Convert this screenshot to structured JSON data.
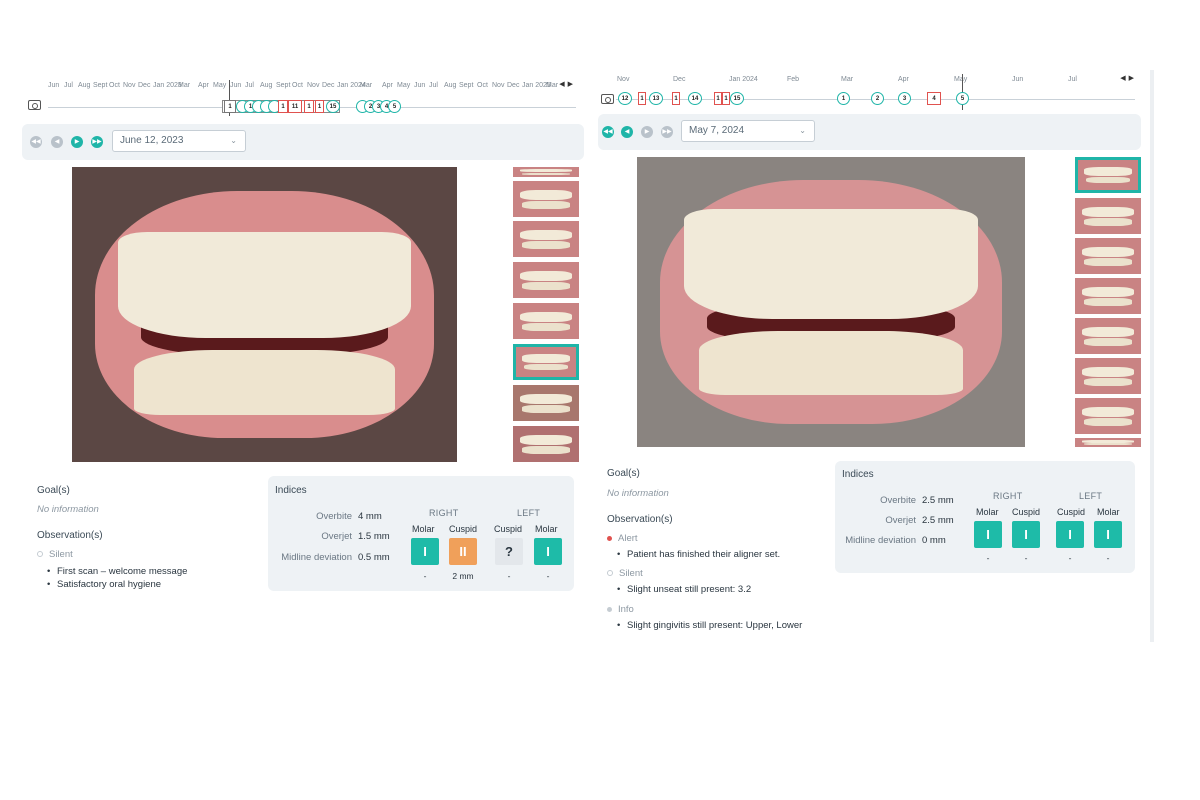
{
  "left": {
    "timeline": {
      "months": [
        "Jun",
        "Jul",
        "Aug",
        "Sept",
        "Oct",
        "Nov",
        "Dec",
        "Jan 2023",
        "Mar",
        "Apr",
        "May",
        "Jun",
        "Jul",
        "Aug",
        "Sept",
        "Oct",
        "Nov",
        "Dec",
        "Jan 2024",
        "Mar",
        "Apr",
        "May",
        "Jun",
        "Jul",
        "Aug",
        "Sept",
        "Oct",
        "Nov",
        "Dec",
        "Jan 2025",
        "Mar"
      ],
      "markers": [
        "1",
        "1",
        "1",
        "1",
        "1",
        "1",
        "11",
        "1",
        "1",
        "1",
        "1",
        "15",
        "1",
        "2",
        "3",
        "4",
        "5"
      ]
    },
    "controls": {
      "date": "June 12, 2023"
    },
    "goals": {
      "label": "Goal(s)",
      "value": "No information"
    },
    "observations": {
      "label": "Observation(s)",
      "groups": [
        {
          "type": "Silent",
          "items": [
            "First scan – welcome message",
            "Satisfactory oral hygiene"
          ]
        }
      ]
    },
    "indices": {
      "title": "Indices",
      "overbite_label": "Overbite",
      "overbite": "4 mm",
      "overjet_label": "Overjet",
      "overjet": "1.5 mm",
      "midline_label": "Midline deviation",
      "midline": "0.5 mm",
      "right_label": "RIGHT",
      "left_label": "LEFT",
      "cols": [
        "Molar",
        "Cuspid",
        "Cuspid",
        "Molar"
      ],
      "classes": [
        "I",
        "II",
        "?",
        "I"
      ],
      "notes": [
        "-",
        "2 mm",
        "-",
        "-"
      ]
    }
  },
  "right": {
    "timeline": {
      "months": [
        "Nov",
        "Dec",
        "Jan 2024",
        "Feb",
        "Mar",
        "Apr",
        "May",
        "Jun",
        "Jul"
      ],
      "markers": [
        "12",
        "1",
        "13",
        "1",
        "14",
        "1",
        "1",
        "15",
        "1",
        "2",
        "3",
        "4",
        "5"
      ]
    },
    "controls": {
      "date": "May 7, 2024"
    },
    "goals": {
      "label": "Goal(s)",
      "value": "No information"
    },
    "observations": {
      "label": "Observation(s)",
      "groups": [
        {
          "type": "Alert",
          "items": [
            "Patient has finished their aligner set."
          ]
        },
        {
          "type": "Silent",
          "items": [
            "Slight unseat still present: 3.2"
          ]
        },
        {
          "type": "Info",
          "items": [
            "Slight gingivitis still present: Upper, Lower"
          ]
        }
      ]
    },
    "indices": {
      "title": "Indices",
      "overbite_label": "Overbite",
      "overbite": "2.5 mm",
      "overjet_label": "Overjet",
      "overjet": "2.5 mm",
      "midline_label": "Midline deviation",
      "midline": "0 mm",
      "right_label": "RIGHT",
      "left_label": "LEFT",
      "cols": [
        "Molar",
        "Cuspid",
        "Cuspid",
        "Molar"
      ],
      "classes": [
        "I",
        "I",
        "I",
        "I"
      ],
      "notes": [
        "-",
        "-",
        "-",
        "-"
      ]
    }
  },
  "colors": {
    "accent": "#1fb5a8",
    "alert": "#e0524f",
    "warning": "#f0a05a"
  },
  "icons": [
    "camera-icon",
    "skip-back-icon",
    "step-back-icon",
    "step-forward-icon",
    "skip-forward-icon",
    "chevron-down-icon",
    "timeline-arrow-left-icon",
    "timeline-arrow-right-icon"
  ]
}
